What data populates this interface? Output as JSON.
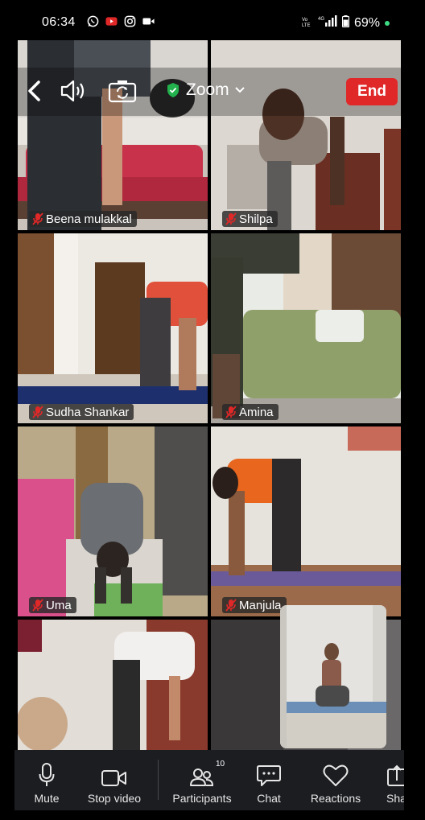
{
  "status_bar": {
    "time": "06:34",
    "battery": "69%",
    "left_icons": [
      "whatsapp-icon",
      "youtube-icon",
      "instagram-icon",
      "video-icon"
    ],
    "right_icons": [
      "volte-icon",
      "signal-icon",
      "battery-icon"
    ]
  },
  "meeting_bar": {
    "title": "Zoom",
    "end_label": "End",
    "end_color": "#e02828"
  },
  "participants": [
    {
      "name": "Beena mulakkal",
      "muted": true
    },
    {
      "name": "Shilpa",
      "muted": true
    },
    {
      "name": "Sudha Shankar",
      "muted": true
    },
    {
      "name": "Amina",
      "muted": true
    },
    {
      "name": "Uma",
      "muted": true
    },
    {
      "name": "Manjula",
      "muted": true
    }
  ],
  "toolbar": {
    "mute": "Mute",
    "stop_video": "Stop video",
    "participants": "Participants",
    "participants_count": "10",
    "chat": "Chat",
    "reactions": "Reactions",
    "share": "Sha"
  },
  "colors": {
    "end_button": "#e02828",
    "muted_mic": "#e02828",
    "secure_shield": "#22b14c",
    "toolbar_bg": "#1c1d21"
  }
}
